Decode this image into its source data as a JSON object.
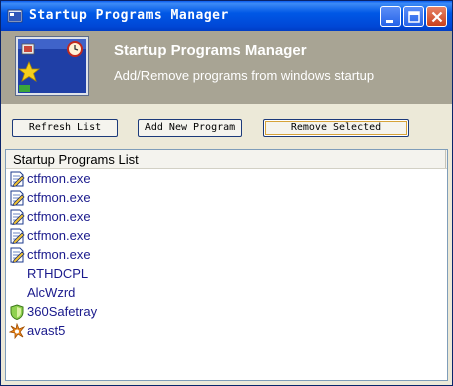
{
  "window": {
    "title": "Startup Programs Manager",
    "title_color": "#ffffff",
    "titlebar_color": "#0054e3"
  },
  "header": {
    "title": "Startup Programs Manager",
    "subtitle": "Add/Remove programs from windows startup",
    "background": "#a8a494"
  },
  "toolbar": {
    "refresh_label": "Refresh List",
    "add_label": "Add New Program",
    "remove_label": "Remove Selected"
  },
  "list": {
    "column_header": "Startup Programs List",
    "item_color": "#1a1a8c",
    "items": [
      {
        "name": "ctfmon.exe",
        "icon": "document-pencil-icon"
      },
      {
        "name": "ctfmon.exe",
        "icon": "document-pencil-icon"
      },
      {
        "name": "ctfmon.exe",
        "icon": "document-pencil-icon"
      },
      {
        "name": "ctfmon.exe",
        "icon": "document-pencil-icon"
      },
      {
        "name": "ctfmon.exe",
        "icon": "document-pencil-icon"
      },
      {
        "name": "RTHDCPL",
        "icon": "none"
      },
      {
        "name": "AlcWzrd",
        "icon": "none"
      },
      {
        "name": "360Safetray",
        "icon": "shield-icon"
      },
      {
        "name": "avast5",
        "icon": "avast-icon"
      }
    ]
  }
}
